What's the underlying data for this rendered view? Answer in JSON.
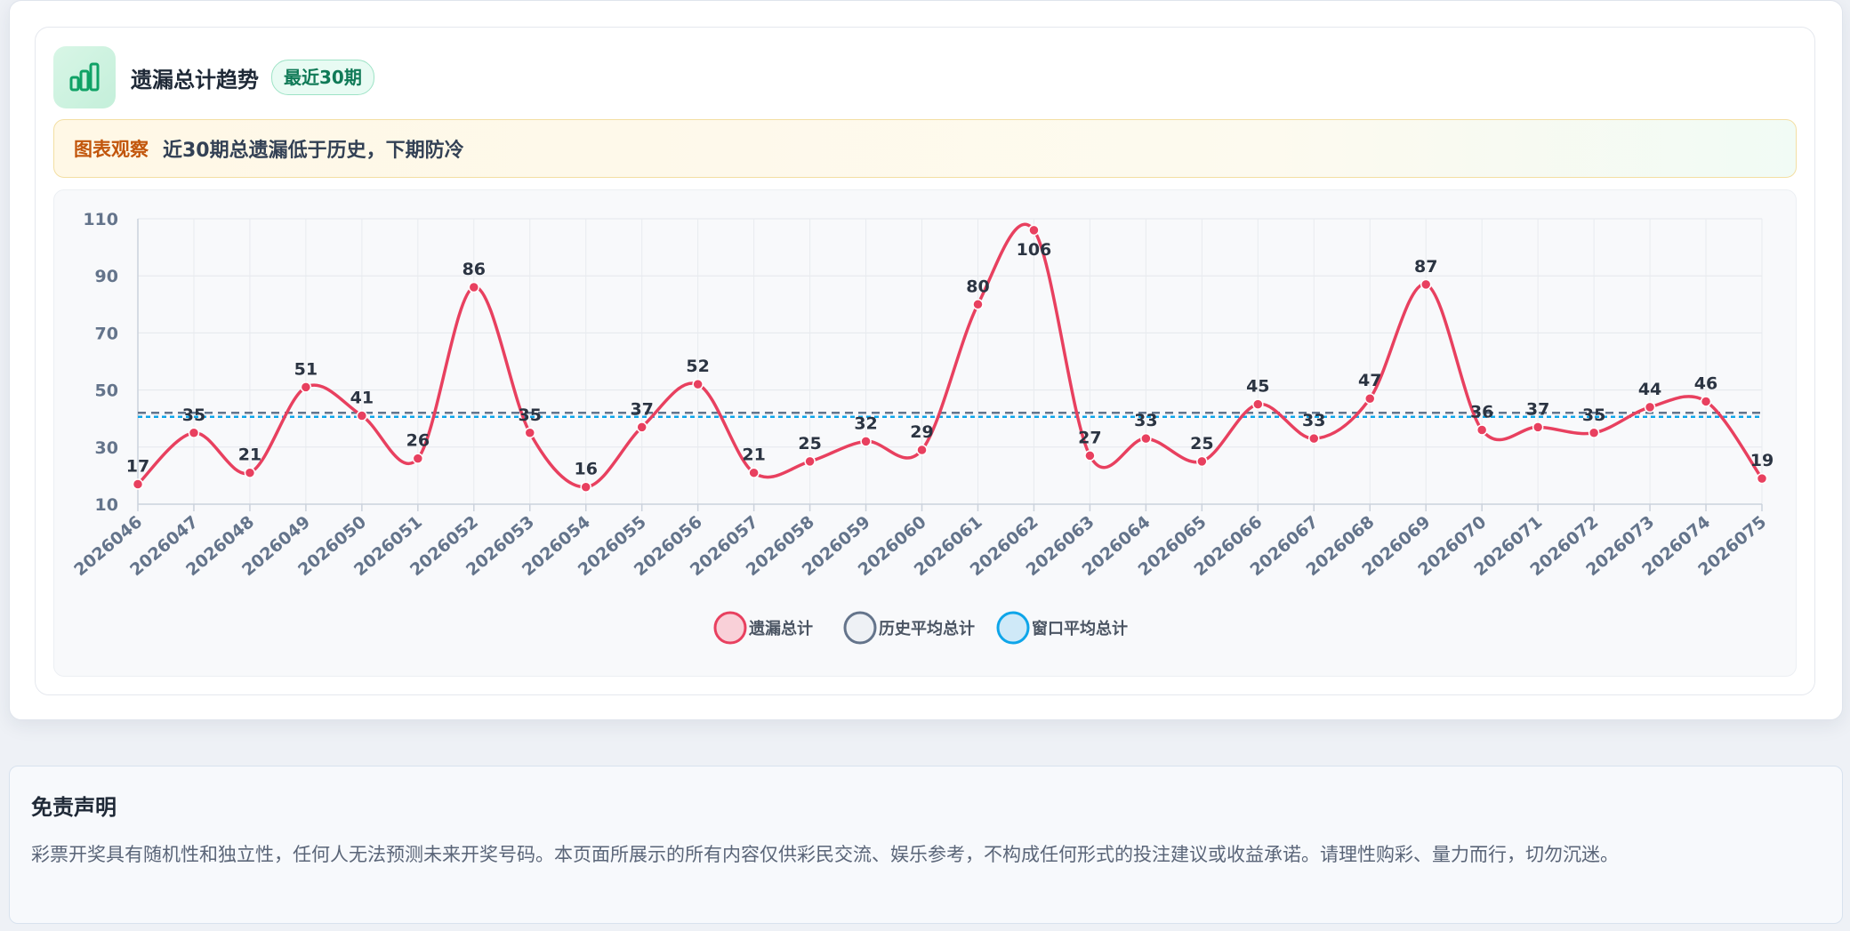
{
  "header": {
    "title": "遗漏总计趋势",
    "badge": "最近30期"
  },
  "observation": {
    "label": "图表观察",
    "text": "近30期总遗漏低于历史，下期防冷"
  },
  "colors": {
    "main": "#e8405f",
    "history": "#64748b",
    "window": "#0ea5e9",
    "accent_green": "#10a266"
  },
  "chart_data": {
    "type": "line",
    "categories": [
      "2026046",
      "2026047",
      "2026048",
      "2026049",
      "2026050",
      "2026051",
      "2026052",
      "2026053",
      "2026054",
      "2026055",
      "2026056",
      "2026057",
      "2026058",
      "2026059",
      "2026060",
      "2026061",
      "2026062",
      "2026063",
      "2026064",
      "2026065",
      "2026066",
      "2026067",
      "2026068",
      "2026069",
      "2026070",
      "2026071",
      "2026072",
      "2026073",
      "2026074",
      "2026075"
    ],
    "series": [
      {
        "name": "遗漏总计",
        "values": [
          17,
          35,
          21,
          51,
          41,
          26,
          86,
          35,
          16,
          37,
          52,
          21,
          25,
          32,
          29,
          80,
          106,
          27,
          33,
          25,
          45,
          33,
          47,
          87,
          36,
          37,
          35,
          44,
          46,
          19
        ]
      },
      {
        "name": "历史平均总计",
        "values": [
          42,
          42,
          42,
          42,
          42,
          42,
          42,
          42,
          42,
          42,
          42,
          42,
          42,
          42,
          42,
          42,
          42,
          42,
          42,
          42,
          42,
          42,
          42,
          42,
          42,
          42,
          42,
          42,
          42,
          42
        ]
      },
      {
        "name": "窗口平均总计",
        "values": [
          40.6,
          40.6,
          40.6,
          40.6,
          40.6,
          40.6,
          40.6,
          40.6,
          40.6,
          40.6,
          40.6,
          40.6,
          40.6,
          40.6,
          40.6,
          40.6,
          40.6,
          40.6,
          40.6,
          40.6,
          40.6,
          40.6,
          40.6,
          40.6,
          40.6,
          40.6,
          40.6,
          40.6,
          40.6,
          40.6
        ]
      }
    ],
    "yticks": [
      10,
      30,
      50,
      70,
      90,
      110
    ],
    "ylim": [
      10,
      110
    ],
    "grid": true,
    "legend": "bottom-center"
  },
  "disclaimer": {
    "title": "免责声明",
    "text": "彩票开奖具有随机性和独立性，任何人无法预测未来开奖号码。本页面所展示的所有内容仅供彩民交流、娱乐参考，不构成任何形式的投注建议或收益承诺。请理性购彩、量力而行，切勿沉迷。"
  }
}
